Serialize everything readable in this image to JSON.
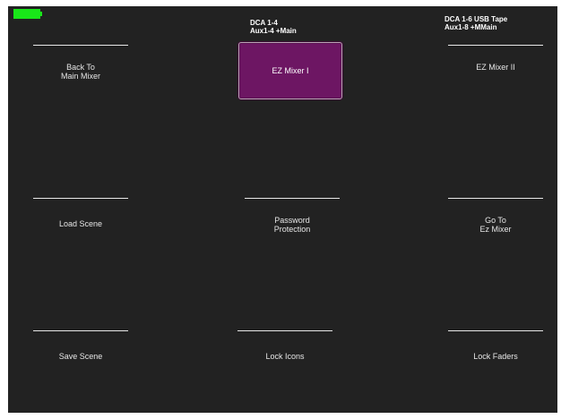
{
  "header": {
    "center_line1": "DCA 1-4",
    "center_line2": "Aux1-4 +Main",
    "right_line1": "DCA 1-6 USB Tape",
    "right_line2": "Aux1-8 +MMain"
  },
  "buttons": {
    "back_to_main_mixer": "Back To\nMain Mixer",
    "ez_mixer_1": "EZ Mixer I",
    "ez_mixer_2": "EZ Mixer II",
    "load_scene": "Load Scene",
    "password_protection": "Password\nProtection",
    "go_to_ez_mixer": "Go To\nEz Mixer",
    "save_scene": "Save Scene",
    "lock_icons": "Lock Icons",
    "lock_faders": "Lock Faders"
  },
  "colors": {
    "background": "#222222",
    "battery": "#19e619",
    "selected_button": "#6d1663"
  },
  "icons": {
    "battery": "battery-icon"
  }
}
